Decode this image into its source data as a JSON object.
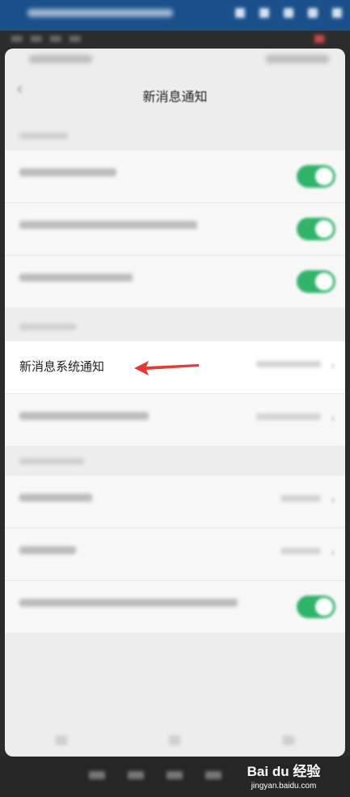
{
  "page": {
    "title": "新消息通知",
    "highlight_row_label": "新消息系统通知"
  },
  "watermark": {
    "brand": "Bai du 经验",
    "url": "jingyan.baidu.com"
  },
  "colors": {
    "toggle_on": "#2fb46a",
    "arrow": "#e53935",
    "background": "#ededed"
  },
  "icons": {
    "back": "chevron-left-icon",
    "chevron": "chevron-right-icon"
  }
}
